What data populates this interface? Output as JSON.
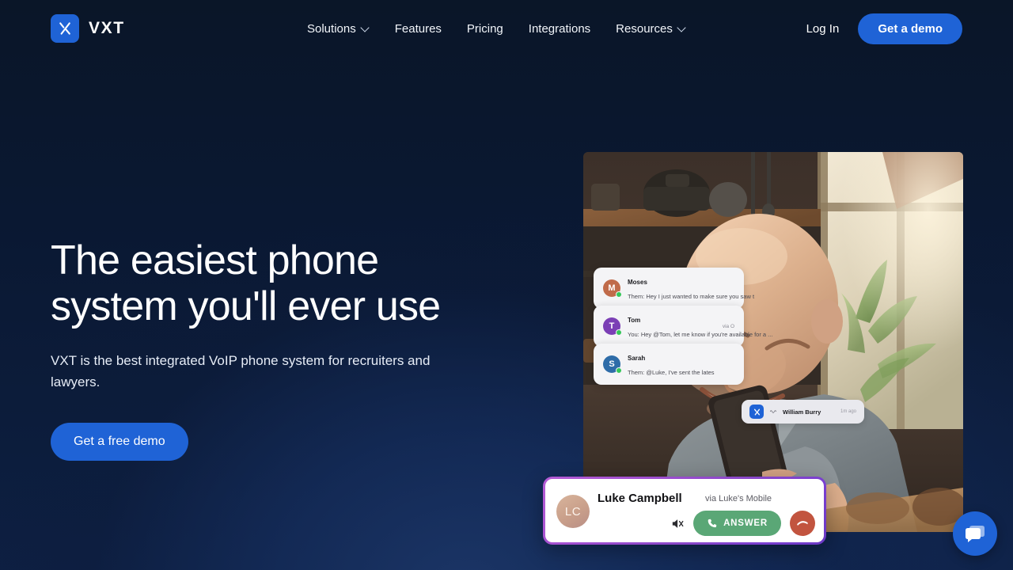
{
  "brand": {
    "name": "VXT",
    "logo_icon": "x-logo-icon",
    "accent": "#1f63d6"
  },
  "nav": {
    "items": [
      {
        "label": "Solutions",
        "has_chevron": true
      },
      {
        "label": "Features",
        "has_chevron": false
      },
      {
        "label": "Pricing",
        "has_chevron": false
      },
      {
        "label": "Integrations",
        "has_chevron": false
      },
      {
        "label": "Resources",
        "has_chevron": true
      }
    ],
    "login_label": "Log In",
    "demo_label": "Get a demo"
  },
  "hero": {
    "title": "The easiest phone\nsystem you'll ever use",
    "subtitle": "VXT is the best integrated VoIP phone system for recruiters and lawyers.",
    "cta_label": "Get a free demo"
  },
  "hero_image": {
    "alt": "Smiling bald man in a sunlit kitchen holding a mobile phone"
  },
  "chat_cards": [
    {
      "name": "Moses",
      "preview": "Them: Hey I just wanted to make sure you saw t",
      "meta": "",
      "initial": "M",
      "color": "#c06b4a",
      "online": true
    },
    {
      "name": "Tom",
      "preview": "You: Hey @Tom, let me know if you're available for a ...",
      "meta": "via O",
      "initial": "T",
      "color": "#7b3fb5",
      "online": true
    },
    {
      "name": "Sarah",
      "preview": "Them: @Luke, I've sent the lates",
      "meta": "",
      "initial": "S",
      "color": "#2e6ca8",
      "online": true
    }
  ],
  "notification": {
    "name": "William Burry",
    "time": "1m ago",
    "logo_icon": "x-logo-icon",
    "wave_icon": "wave-icon"
  },
  "incoming_call": {
    "caller_name": "Luke Campbell",
    "via_label": "via Luke's Mobile",
    "avatar_initials": "LC",
    "answer_label": "ANSWER",
    "mute_icon": "mute-icon",
    "phone_icon": "phone-icon",
    "decline_icon": "phone-hangup-icon",
    "border_color": "#a14fd0",
    "answer_color": "#5aa776",
    "decline_color": "#c2543f"
  },
  "chat_widget": {
    "icon": "chat-bubbles-icon",
    "color": "#1f63d6"
  }
}
